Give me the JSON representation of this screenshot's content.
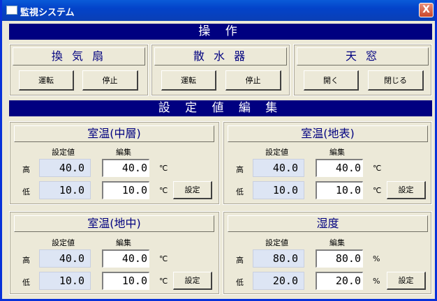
{
  "window": {
    "title": "監視システム",
    "close_label": "X"
  },
  "operation": {
    "banner": "操 作",
    "groups": [
      {
        "title": "換 気 扇",
        "buttons": [
          "運転",
          "停止"
        ]
      },
      {
        "title": "散 水 器",
        "buttons": [
          "運転",
          "停止"
        ]
      },
      {
        "title": "天 窓",
        "buttons": [
          "開く",
          "閉じる"
        ]
      }
    ]
  },
  "settings": {
    "banner": "設 定 値 編 集",
    "header_set": "設定値",
    "header_edit": "編集",
    "high_label": "高",
    "low_label": "低",
    "button_label": "設定",
    "panels": [
      {
        "title": "室温(中層)",
        "high_set": "40.0",
        "high_edit": "40.0",
        "low_set": "10.0",
        "low_edit": "10.0",
        "unit": "℃"
      },
      {
        "title": "室温(地表)",
        "high_set": "40.0",
        "high_edit": "40.0",
        "low_set": "10.0",
        "low_edit": "10.0",
        "unit": "℃"
      },
      {
        "title": "室温(地中)",
        "high_set": "40.0",
        "high_edit": "40.0",
        "low_set": "10.0",
        "low_edit": "10.0",
        "unit": "℃"
      },
      {
        "title": "湿度",
        "high_set": "80.0",
        "high_edit": "80.0",
        "low_set": "20.0",
        "low_edit": "20.0",
        "unit": "%"
      }
    ]
  }
}
